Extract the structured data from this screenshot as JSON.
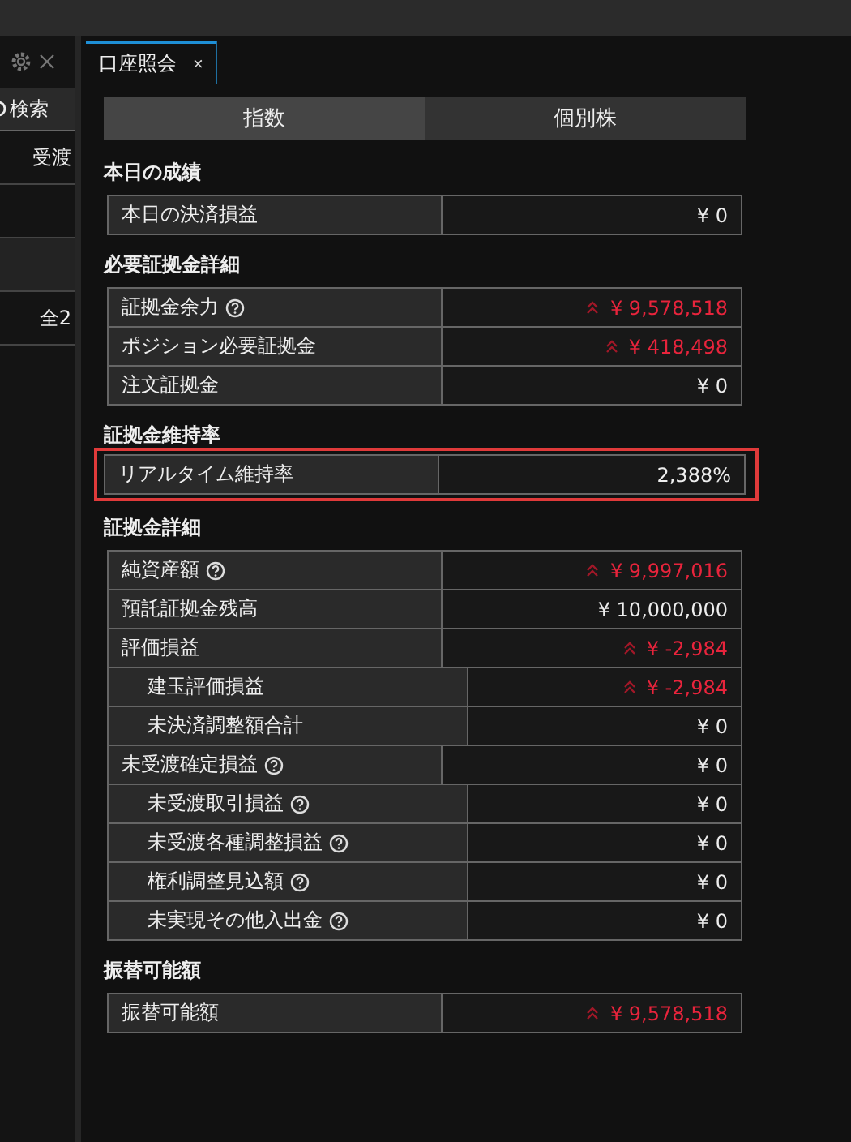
{
  "side_panel": {
    "search_label": "検索",
    "row_labels": [
      "受渡",
      "全2"
    ]
  },
  "tab": {
    "title": "口座照会",
    "close": "×"
  },
  "segments": [
    {
      "label": "指数",
      "selected": true
    },
    {
      "label": "個別株",
      "selected": false
    }
  ],
  "sections": [
    {
      "title": "本日の成績",
      "outlined": false,
      "rows": [
        {
          "label": "本日の決済損益",
          "value": "¥ 0",
          "help": false,
          "alert": false
        }
      ]
    },
    {
      "title": "必要証拠金詳細",
      "outlined": false,
      "rows": [
        {
          "label": "証拠金余力",
          "value": "¥ 9,578,518",
          "help": true,
          "alert": true
        },
        {
          "label": "ポジション必要証拠金",
          "value": "¥ 418,498",
          "help": false,
          "alert": true
        },
        {
          "label": "注文証拠金",
          "value": "¥ 0",
          "help": false,
          "alert": false
        }
      ]
    },
    {
      "title": "証拠金維持率",
      "outlined": true,
      "rows": [
        {
          "label": "リアルタイム維持率",
          "value": "2,388%",
          "help": false,
          "alert": false
        }
      ]
    },
    {
      "title": "証拠金詳細",
      "outlined": false,
      "rows": [
        {
          "label": "純資産額",
          "value": "¥ 9,997,016",
          "help": true,
          "alert": true
        },
        {
          "label": "預託証拠金残高",
          "value": "¥ 10,000,000",
          "help": false,
          "alert": false
        },
        {
          "label": "評価損益",
          "value": "¥ -2,984",
          "help": false,
          "alert": true,
          "children": [
            {
              "label": "建玉評価損益",
              "value": "¥ -2,984",
              "help": false,
              "alert": true
            },
            {
              "label": "未決済調整額合計",
              "value": "¥ 0",
              "help": false,
              "alert": false
            }
          ]
        },
        {
          "label": "未受渡確定損益",
          "value": "¥ 0",
          "help": true,
          "alert": false,
          "children": [
            {
              "label": "未受渡取引損益",
              "value": "¥ 0",
              "help": true,
              "alert": false
            },
            {
              "label": "未受渡各種調整損益",
              "value": "¥ 0",
              "help": true,
              "alert": false
            },
            {
              "label": "権利調整見込額",
              "value": "¥ 0",
              "help": true,
              "alert": false
            },
            {
              "label": "未実現その他入出金",
              "value": "¥ 0",
              "help": true,
              "alert": false
            }
          ]
        }
      ]
    },
    {
      "title": "振替可能額",
      "outlined": false,
      "rows": [
        {
          "label": "振替可能額",
          "value": "¥ 9,578,518",
          "help": false,
          "alert": true
        }
      ]
    }
  ]
}
